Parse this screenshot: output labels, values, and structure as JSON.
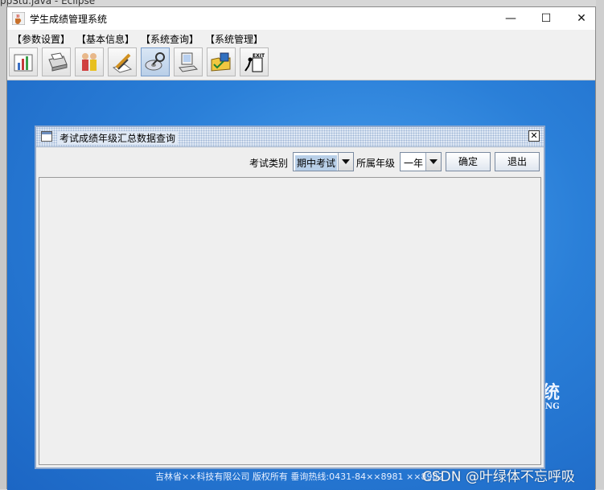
{
  "background": {
    "eclipse_title": "ppStu.java - Eclipse"
  },
  "window": {
    "title": "学生成绩管理系统",
    "controls": {
      "minimize": "—",
      "maximize": "☐",
      "close": "✕"
    }
  },
  "menu": [
    "【参数设置】",
    "【基本信息】",
    "【系统查询】",
    "【系统管理】"
  ],
  "toolbar": {
    "buttons": [
      {
        "icon": "chart-icon"
      },
      {
        "icon": "printer-icon"
      },
      {
        "icon": "people-icon"
      },
      {
        "icon": "edit-pencil-icon"
      },
      {
        "icon": "search-disc-icon",
        "active": true
      },
      {
        "icon": "computer-icon"
      },
      {
        "icon": "folder-check-icon"
      },
      {
        "icon": "exit-icon",
        "label": "EXIT"
      }
    ]
  },
  "desktop": {
    "logo_text": "统",
    "logo_sub": "NG",
    "footer": "吉林省××科技有限公司  版权所有     垂询热线:0431-84××8981  ××8982",
    "watermark": "CSDN @叶绿体不忘呼吸"
  },
  "query_frame": {
    "title": "考试成绩年级汇总数据查询",
    "close": "✕",
    "exam_type_label": "考试类别",
    "exam_type_value": "期中考试",
    "grade_label": "所属年级",
    "grade_value": "一年",
    "confirm_label": "确定",
    "exit_label": "退出"
  },
  "colors": {
    "desktop_blue": "#2a7fd8",
    "frame_border": "#8fa8cc"
  }
}
